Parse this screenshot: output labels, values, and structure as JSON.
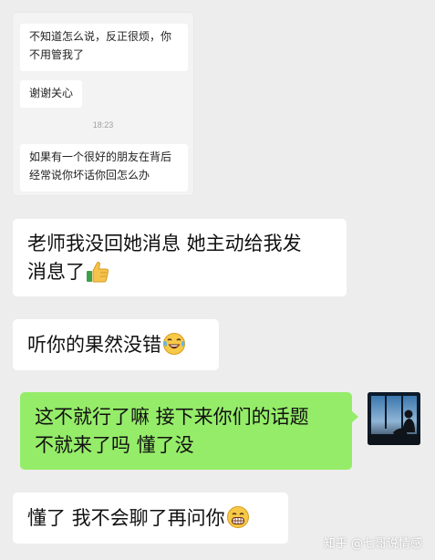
{
  "embedded_chat": {
    "msg1_line1": "不知道怎么说，反正很烦，你",
    "msg1_line2": "不用管我了",
    "msg2": "谢谢关心",
    "time": "18:23",
    "msg3_line1": "如果有一个很好的朋友在背后",
    "msg3_line2": "经常说你坏话你回怎么办"
  },
  "messages": [
    {
      "side": "left",
      "line1": "老师我没回她消息 她主动给我发",
      "line2": "消息了",
      "emoji": "thumbs-up"
    },
    {
      "side": "left",
      "line1": "听你的果然没错",
      "emoji": "laughing-tears"
    },
    {
      "side": "right",
      "line1": "这不就行了嘛 接下来你们的话题",
      "line2": "不就来了吗 懂了没"
    },
    {
      "side": "left",
      "line1": "懂了 我不会聊了再问你",
      "emoji": "grinning"
    }
  ],
  "watermark": "知乎 @七哥说情感",
  "colors": {
    "background": "#ededed",
    "self_bubble": "#95ec69",
    "other_bubble": "#ffffff"
  }
}
